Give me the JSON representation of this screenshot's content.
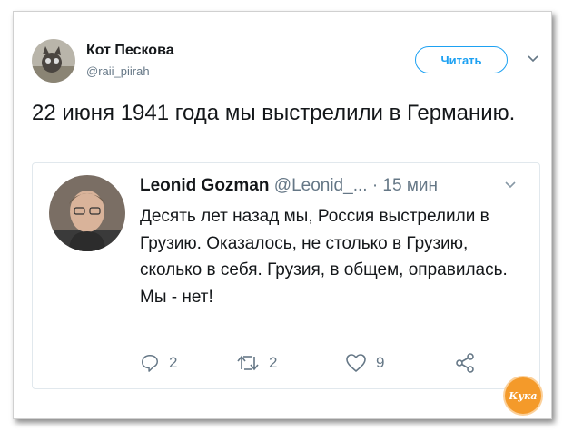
{
  "tweet": {
    "author_name": "Кот Пескова",
    "author_handle": "@raii_piirah",
    "follow_label": "Читать",
    "text": "22 июня 1941 года мы выстрелили в Германию."
  },
  "quoted": {
    "author_name": "Leonid Gozman",
    "author_handle": "@Leonid_...",
    "time": "· 15 мин",
    "text": "Десять лет назад мы, Россия выстрелили в Грузию. Оказалось, не столько в Грузию, сколько в себя. Грузия, в общем, оправилась. Мы - нет!",
    "reply_count": "2",
    "retweet_count": "2",
    "like_count": "9"
  },
  "icons": {
    "reply": "reply-icon",
    "retweet": "retweet-icon",
    "like": "heart-icon",
    "share": "share-icon",
    "more": "chevron-down-icon"
  },
  "colors": {
    "accent": "#1da1f2",
    "muted": "#657786",
    "text": "#14171a",
    "watermark": "#f49a2a"
  },
  "watermark": {
    "label": "Кука"
  }
}
